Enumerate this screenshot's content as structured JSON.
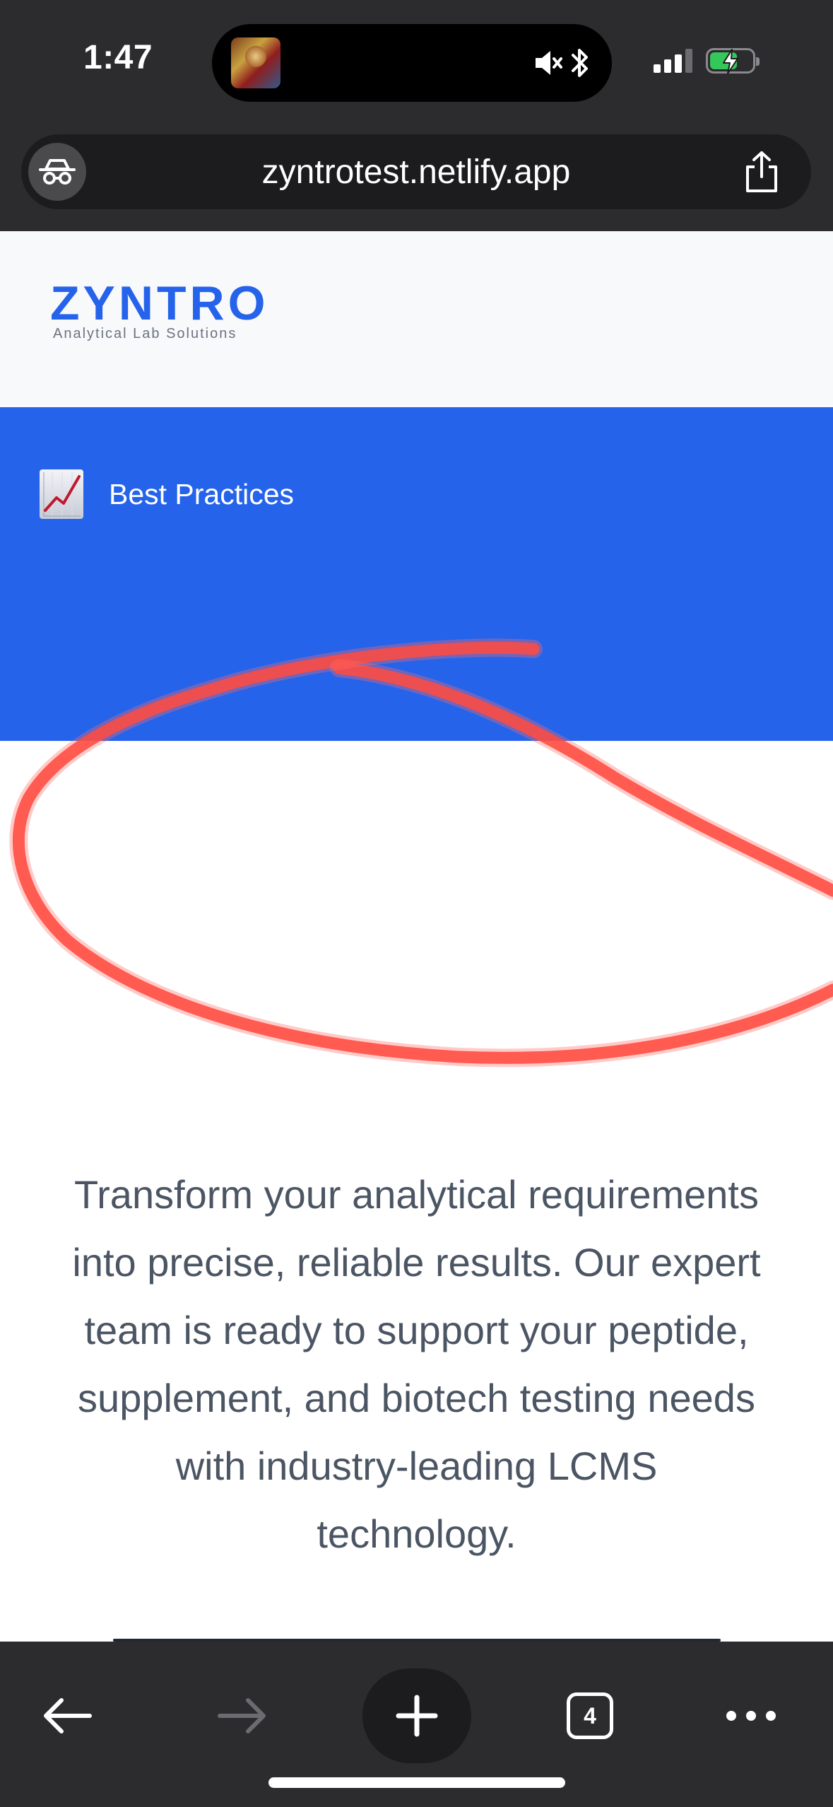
{
  "status_bar": {
    "time": "1:47",
    "now_playing_icon": "religious-icon-thumbnail",
    "mute_icon": "speaker-muted-icon",
    "bluetooth_icon": "bluetooth-icon",
    "signal_icon": "cellular-signal-icon",
    "battery_icon": "battery-charging-icon",
    "battery_level": 0.66,
    "battery_color": "#34c759"
  },
  "browser": {
    "url": "zyntrotest.netlify.app",
    "privacy_icon": "incognito-icon",
    "share_icon": "share-icon",
    "chrome_color": "#2c2c2e"
  },
  "site": {
    "logo": "ZYNTRO",
    "tagline": "Analytical Lab Solutions",
    "brand_color": "#2563eb",
    "nav": {
      "items": [
        {
          "icon": "chart-increasing-icon",
          "label": "Best Practices"
        }
      ]
    },
    "body_text": "Transform your analytical requirements into precise, reliable results. Our expert team is ready to support your peptide, supplement, and biotech testing needs with industry-leading LCMS technology."
  },
  "annotation": {
    "type": "hand-drawn-circle",
    "color": "#ff3b30"
  },
  "toolbar": {
    "back_icon": "arrow-left-icon",
    "forward_icon": "arrow-right-icon",
    "new_tab_icon": "plus-icon",
    "tab_count": "4",
    "more_icon": "more-horizontal-icon"
  }
}
